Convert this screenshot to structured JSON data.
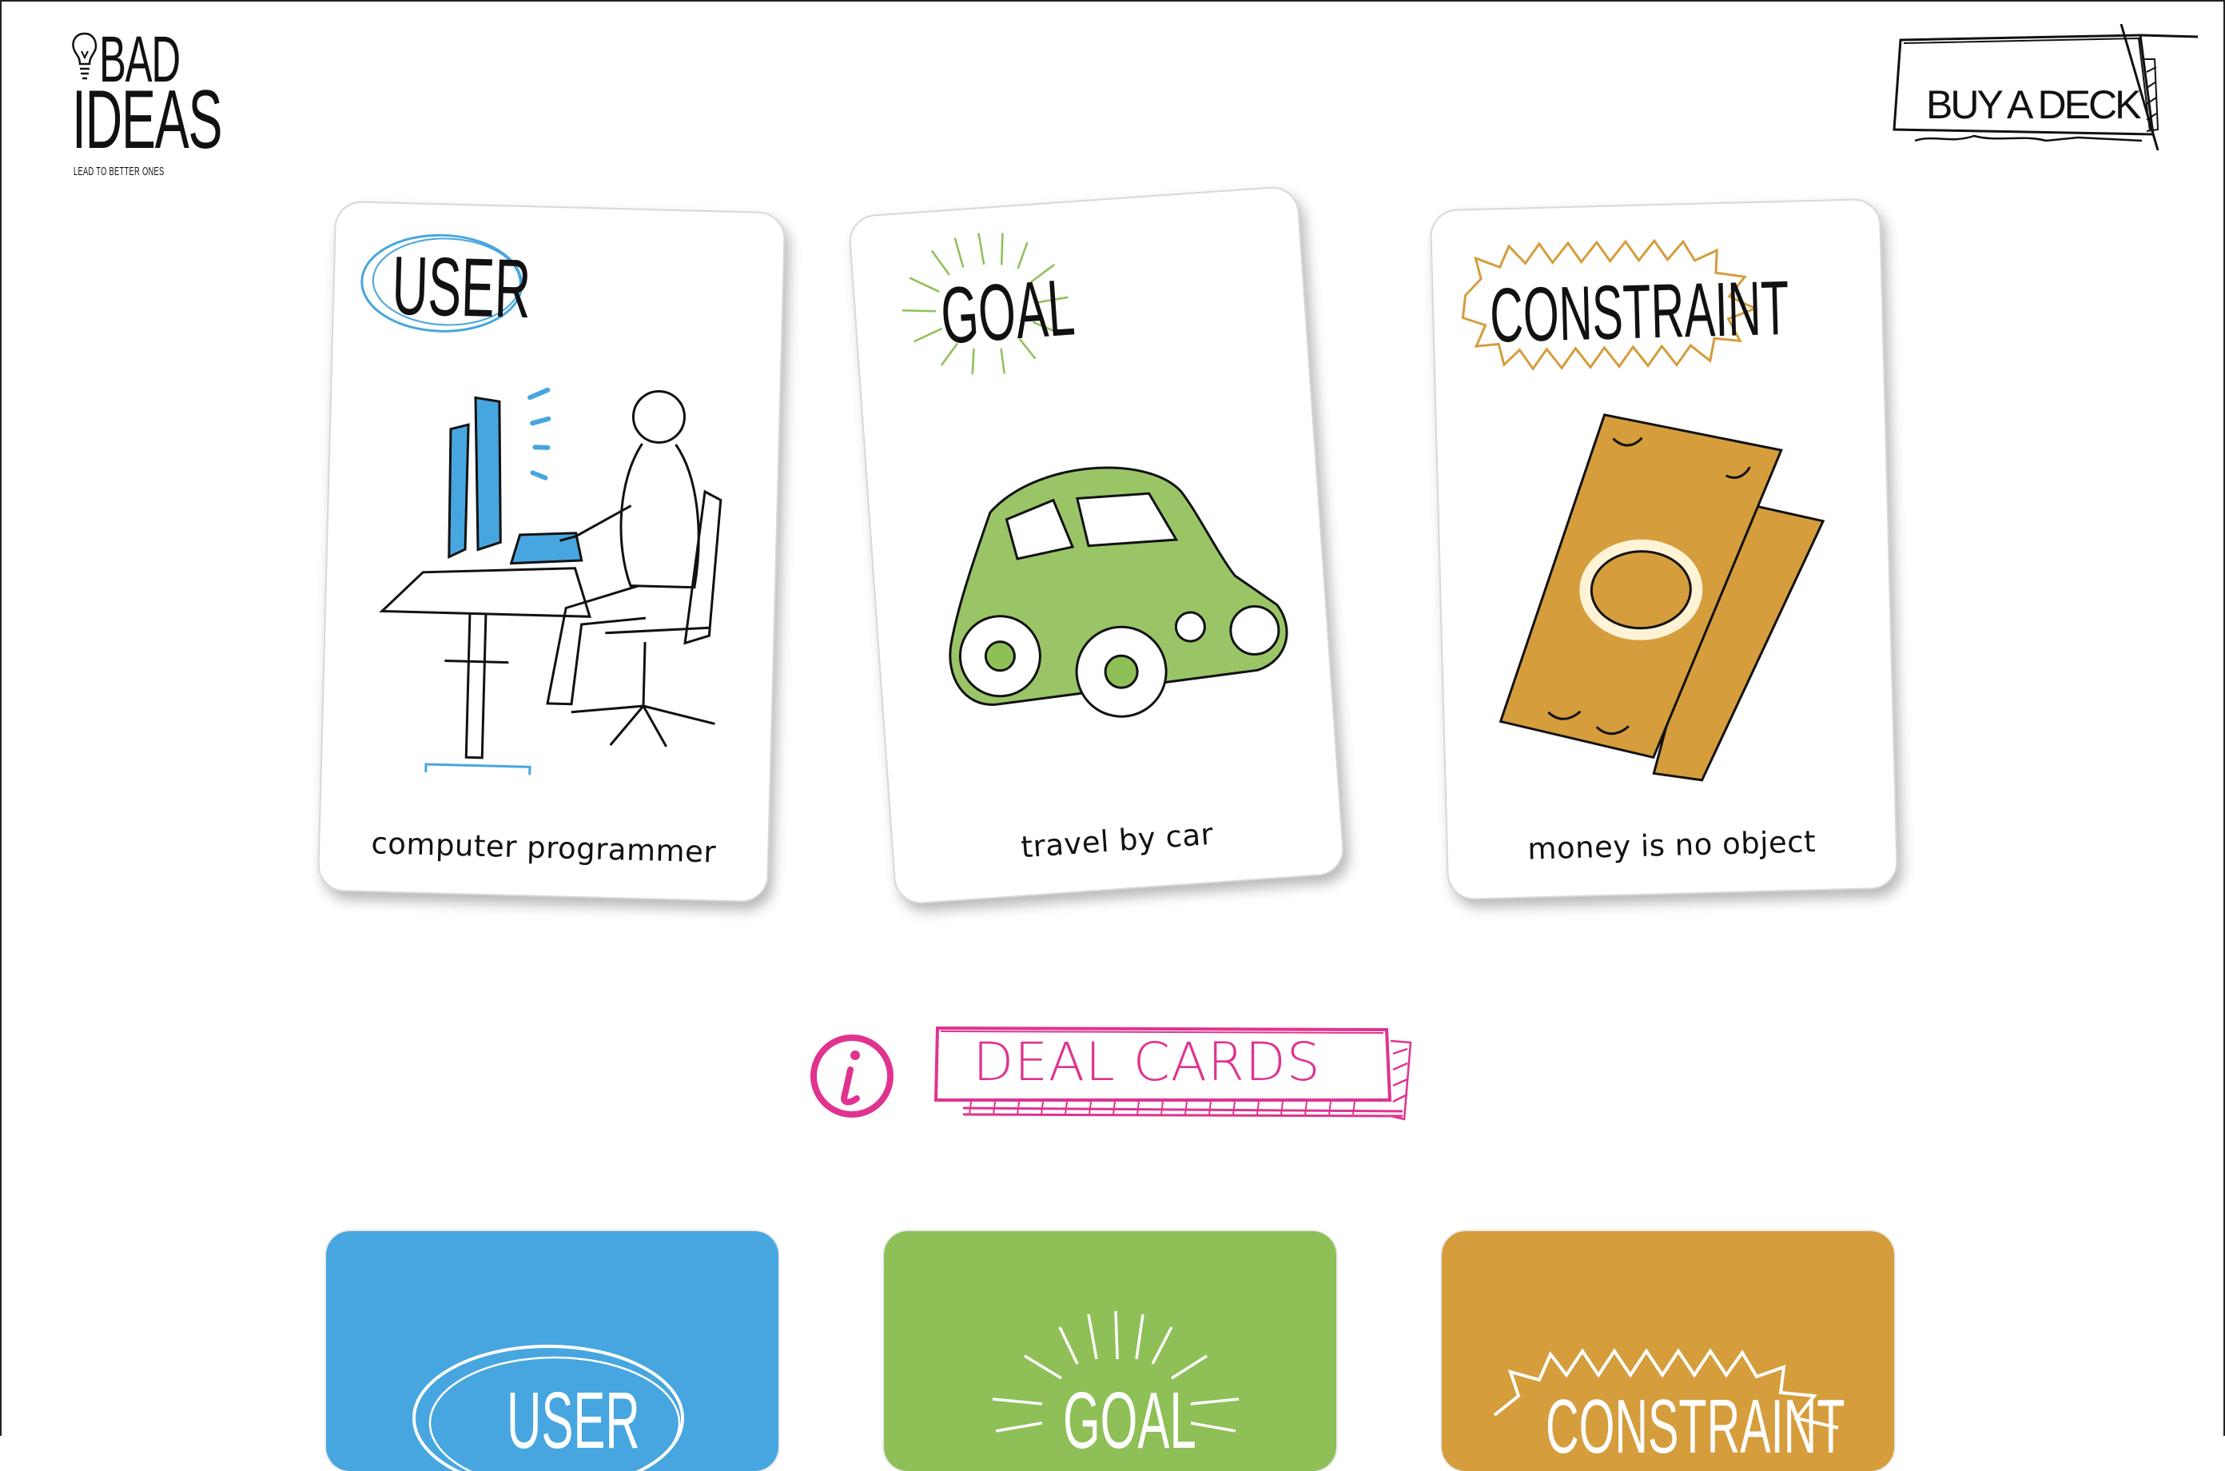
{
  "logo": {
    "line1": "BAD",
    "line2": "IDEAS",
    "tagline": "LEAD TO BETTER ONES"
  },
  "header": {
    "buy_label": "BUY A DECK"
  },
  "cards": {
    "user": {
      "heading": "USER",
      "caption": "computer programmer",
      "accent": "#47a6df"
    },
    "goal": {
      "heading": "GOAL",
      "caption": "travel by car",
      "accent": "#8fbf57"
    },
    "constraint": {
      "heading": "CONSTRAINT",
      "caption": "money is no object",
      "accent": "#d59d3c"
    }
  },
  "actions": {
    "info_icon": "info-icon",
    "deal_label": "DEAL CARDS",
    "deal_color": "#e0338f"
  },
  "decks": {
    "user": {
      "label": "USER",
      "color": "#47a6df"
    },
    "goal": {
      "label": "GOAL",
      "color": "#8fbf57"
    },
    "constraint": {
      "label": "CONSTRAINT",
      "color": "#d59d3c"
    }
  }
}
